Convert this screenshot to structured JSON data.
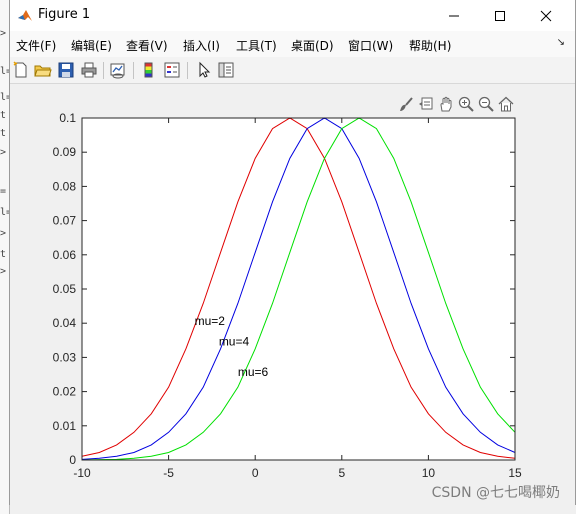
{
  "left_strip": {
    "items": [
      ">",
      "l=",
      "t",
      ">",
      "=",
      "l=",
      "t",
      ">",
      "l=",
      "t",
      ">"
    ]
  },
  "window": {
    "title": "Figure 1",
    "controls": [
      "minimize",
      "maximize",
      "close"
    ]
  },
  "menubar": {
    "items": [
      {
        "label": "文件(F)"
      },
      {
        "label": "编辑(E)"
      },
      {
        "label": "查看(V)"
      },
      {
        "label": "插入(I)"
      },
      {
        "label": "工具(T)"
      },
      {
        "label": "桌面(D)"
      },
      {
        "label": "窗口(W)"
      },
      {
        "label": "帮助(H)"
      }
    ],
    "overflow_glyph": "↘"
  },
  "toolbar": {
    "icons": [
      "new-figure-icon",
      "open-file-icon",
      "save-icon",
      "print-icon",
      "link-plot-icon",
      "colorbar-icon",
      "legend-icon",
      "pointer-icon",
      "property-inspector-icon"
    ]
  },
  "axes_toolbar": {
    "icons": [
      "brush-icon",
      "data-tips-icon",
      "pan-icon",
      "zoom-in-icon",
      "zoom-out-icon",
      "home-icon"
    ]
  },
  "chart_data": {
    "type": "line",
    "title": "",
    "xlabel": "",
    "ylabel": "",
    "xlim": [
      -10,
      15
    ],
    "ylim": [
      0,
      0.1
    ],
    "xticks": [
      "-10",
      "-5",
      "0",
      "5",
      "10",
      "15"
    ],
    "yticks": [
      "0",
      "0.01",
      "0.02",
      "0.03",
      "0.04",
      "0.05",
      "0.06",
      "0.07",
      "0.08",
      "0.09",
      "0.1"
    ],
    "x": [
      -10,
      -9,
      -8,
      -7,
      -6,
      -5,
      -4,
      -3,
      -2,
      -1,
      0,
      1,
      2,
      3,
      4,
      5,
      6,
      7,
      8,
      9,
      10,
      11,
      12,
      13,
      14,
      15
    ],
    "series": [
      {
        "color": "#e00000",
        "values": [
          0.0011,
          0.0022,
          0.0044,
          0.0081,
          0.0135,
          0.0213,
          0.0325,
          0.0458,
          0.0607,
          0.0755,
          0.0882,
          0.0969,
          0.1,
          0.0969,
          0.0882,
          0.0755,
          0.0607,
          0.0458,
          0.0325,
          0.0213,
          0.0135,
          0.0081,
          0.0044,
          0.0022,
          0.0011,
          0.0005
        ]
      },
      {
        "color": "#0000e0",
        "values": [
          0.0002,
          0.0005,
          0.0011,
          0.0022,
          0.0044,
          0.0081,
          0.0135,
          0.0213,
          0.0325,
          0.0458,
          0.0607,
          0.0755,
          0.0882,
          0.0969,
          0.1,
          0.0969,
          0.0882,
          0.0755,
          0.0607,
          0.0458,
          0.0325,
          0.0213,
          0.0135,
          0.0081,
          0.0044,
          0.0022
        ]
      },
      {
        "color": "#00e000",
        "values": [
          0.0,
          0.0001,
          0.0002,
          0.0005,
          0.0011,
          0.0022,
          0.0044,
          0.0081,
          0.0135,
          0.0213,
          0.0325,
          0.0458,
          0.0607,
          0.0755,
          0.0882,
          0.0969,
          0.1,
          0.0969,
          0.0882,
          0.0755,
          0.0607,
          0.0458,
          0.0325,
          0.0213,
          0.0135,
          0.0081
        ]
      }
    ],
    "annotations": [
      {
        "text": "mu=2",
        "x": -3.5,
        "y": 0.0395
      },
      {
        "text": "mu=4",
        "x": -2.1,
        "y": 0.0335
      },
      {
        "text": "mu=6",
        "x": -1.0,
        "y": 0.0245
      }
    ],
    "grid": false,
    "legend": "none"
  },
  "watermark": "CSDN @七七喝椰奶"
}
